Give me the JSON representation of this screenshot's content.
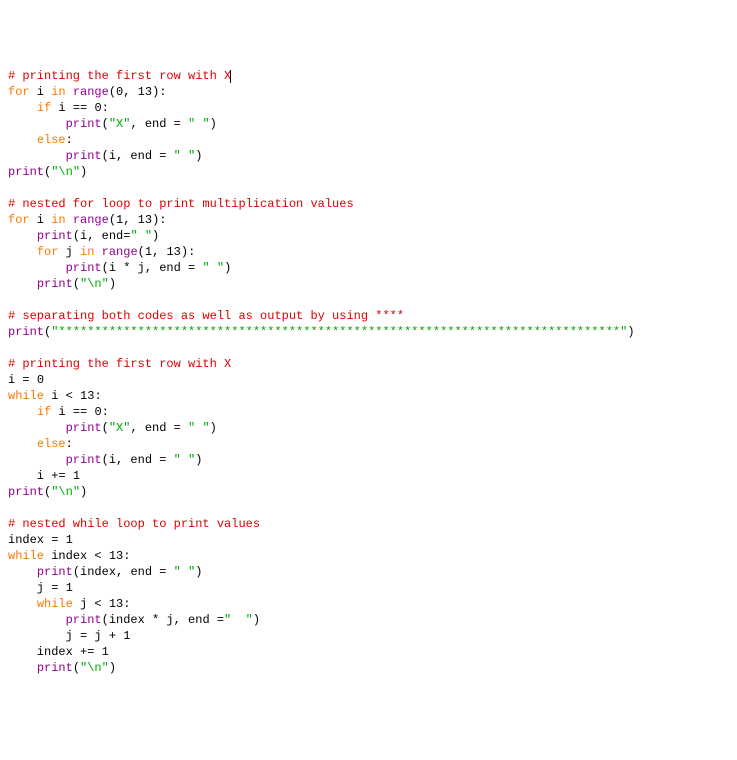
{
  "lines": [
    {
      "tokens": [
        {
          "t": "# printing the first row with X",
          "c": "cm"
        }
      ],
      "cursor": true
    },
    {
      "tokens": [
        {
          "t": "for",
          "c": "kw"
        },
        {
          "t": " i ",
          "c": "pl"
        },
        {
          "t": "in",
          "c": "kw"
        },
        {
          "t": " ",
          "c": "pl"
        },
        {
          "t": "range",
          "c": "bn"
        },
        {
          "t": "(",
          "c": "pl"
        },
        {
          "t": "0",
          "c": "pl"
        },
        {
          "t": ", ",
          "c": "pl"
        },
        {
          "t": "13",
          "c": "pl"
        },
        {
          "t": "):",
          "c": "pl"
        }
      ]
    },
    {
      "tokens": [
        {
          "t": "    ",
          "c": "pl"
        },
        {
          "t": "if",
          "c": "kw"
        },
        {
          "t": " i == ",
          "c": "pl"
        },
        {
          "t": "0",
          "c": "pl"
        },
        {
          "t": ":",
          "c": "pl"
        }
      ]
    },
    {
      "tokens": [
        {
          "t": "        ",
          "c": "pl"
        },
        {
          "t": "print",
          "c": "bn"
        },
        {
          "t": "(",
          "c": "pl"
        },
        {
          "t": "\"X\"",
          "c": "st"
        },
        {
          "t": ", end = ",
          "c": "pl"
        },
        {
          "t": "\" \"",
          "c": "st"
        },
        {
          "t": ")",
          "c": "pl"
        }
      ]
    },
    {
      "tokens": [
        {
          "t": "    ",
          "c": "pl"
        },
        {
          "t": "else",
          "c": "kw"
        },
        {
          "t": ":",
          "c": "pl"
        }
      ]
    },
    {
      "tokens": [
        {
          "t": "        ",
          "c": "pl"
        },
        {
          "t": "print",
          "c": "bn"
        },
        {
          "t": "(i, end = ",
          "c": "pl"
        },
        {
          "t": "\" \"",
          "c": "st"
        },
        {
          "t": ")",
          "c": "pl"
        }
      ]
    },
    {
      "tokens": [
        {
          "t": "print",
          "c": "bn"
        },
        {
          "t": "(",
          "c": "pl"
        },
        {
          "t": "\"\\n\"",
          "c": "st"
        },
        {
          "t": ")",
          "c": "pl"
        }
      ]
    },
    {
      "tokens": [
        {
          "t": "",
          "c": "pl"
        }
      ]
    },
    {
      "tokens": [
        {
          "t": "# nested for loop to print multiplication values",
          "c": "cm"
        }
      ]
    },
    {
      "tokens": [
        {
          "t": "for",
          "c": "kw"
        },
        {
          "t": " i ",
          "c": "pl"
        },
        {
          "t": "in",
          "c": "kw"
        },
        {
          "t": " ",
          "c": "pl"
        },
        {
          "t": "range",
          "c": "bn"
        },
        {
          "t": "(",
          "c": "pl"
        },
        {
          "t": "1",
          "c": "pl"
        },
        {
          "t": ", ",
          "c": "pl"
        },
        {
          "t": "13",
          "c": "pl"
        },
        {
          "t": "):",
          "c": "pl"
        }
      ]
    },
    {
      "tokens": [
        {
          "t": "    ",
          "c": "pl"
        },
        {
          "t": "print",
          "c": "bn"
        },
        {
          "t": "(i, end=",
          "c": "pl"
        },
        {
          "t": "\" \"",
          "c": "st"
        },
        {
          "t": ")",
          "c": "pl"
        }
      ]
    },
    {
      "tokens": [
        {
          "t": "    ",
          "c": "pl"
        },
        {
          "t": "for",
          "c": "kw"
        },
        {
          "t": " j ",
          "c": "pl"
        },
        {
          "t": "in",
          "c": "kw"
        },
        {
          "t": " ",
          "c": "pl"
        },
        {
          "t": "range",
          "c": "bn"
        },
        {
          "t": "(",
          "c": "pl"
        },
        {
          "t": "1",
          "c": "pl"
        },
        {
          "t": ", ",
          "c": "pl"
        },
        {
          "t": "13",
          "c": "pl"
        },
        {
          "t": "):",
          "c": "pl"
        }
      ]
    },
    {
      "tokens": [
        {
          "t": "        ",
          "c": "pl"
        },
        {
          "t": "print",
          "c": "bn"
        },
        {
          "t": "(i * j, end = ",
          "c": "pl"
        },
        {
          "t": "\" \"",
          "c": "st"
        },
        {
          "t": ")",
          "c": "pl"
        }
      ]
    },
    {
      "tokens": [
        {
          "t": "    ",
          "c": "pl"
        },
        {
          "t": "print",
          "c": "bn"
        },
        {
          "t": "(",
          "c": "pl"
        },
        {
          "t": "\"\\n\"",
          "c": "st"
        },
        {
          "t": ")",
          "c": "pl"
        }
      ]
    },
    {
      "tokens": [
        {
          "t": "",
          "c": "pl"
        }
      ]
    },
    {
      "tokens": [
        {
          "t": "# separating both codes as well as output by using ****",
          "c": "cm"
        }
      ]
    },
    {
      "tokens": [
        {
          "t": "print",
          "c": "bn"
        },
        {
          "t": "(",
          "c": "pl"
        },
        {
          "t": "\"******************************************************************************\"",
          "c": "st"
        },
        {
          "t": ")",
          "c": "pl"
        }
      ]
    },
    {
      "tokens": [
        {
          "t": "",
          "c": "pl"
        }
      ]
    },
    {
      "tokens": [
        {
          "t": "# printing the first row with X",
          "c": "cm"
        }
      ]
    },
    {
      "tokens": [
        {
          "t": "i = ",
          "c": "pl"
        },
        {
          "t": "0",
          "c": "pl"
        }
      ]
    },
    {
      "tokens": [
        {
          "t": "while",
          "c": "kw"
        },
        {
          "t": " i < ",
          "c": "pl"
        },
        {
          "t": "13",
          "c": "pl"
        },
        {
          "t": ":",
          "c": "pl"
        }
      ]
    },
    {
      "tokens": [
        {
          "t": "    ",
          "c": "pl"
        },
        {
          "t": "if",
          "c": "kw"
        },
        {
          "t": " i == ",
          "c": "pl"
        },
        {
          "t": "0",
          "c": "pl"
        },
        {
          "t": ":",
          "c": "pl"
        }
      ]
    },
    {
      "tokens": [
        {
          "t": "        ",
          "c": "pl"
        },
        {
          "t": "print",
          "c": "bn"
        },
        {
          "t": "(",
          "c": "pl"
        },
        {
          "t": "\"X\"",
          "c": "st"
        },
        {
          "t": ", end = ",
          "c": "pl"
        },
        {
          "t": "\" \"",
          "c": "st"
        },
        {
          "t": ")",
          "c": "pl"
        }
      ]
    },
    {
      "tokens": [
        {
          "t": "    ",
          "c": "pl"
        },
        {
          "t": "else",
          "c": "kw"
        },
        {
          "t": ":",
          "c": "pl"
        }
      ]
    },
    {
      "tokens": [
        {
          "t": "        ",
          "c": "pl"
        },
        {
          "t": "print",
          "c": "bn"
        },
        {
          "t": "(i, end = ",
          "c": "pl"
        },
        {
          "t": "\" \"",
          "c": "st"
        },
        {
          "t": ")",
          "c": "pl"
        }
      ]
    },
    {
      "tokens": [
        {
          "t": "    i += ",
          "c": "pl"
        },
        {
          "t": "1",
          "c": "pl"
        }
      ]
    },
    {
      "tokens": [
        {
          "t": "print",
          "c": "bn"
        },
        {
          "t": "(",
          "c": "pl"
        },
        {
          "t": "\"\\n\"",
          "c": "st"
        },
        {
          "t": ")",
          "c": "pl"
        }
      ]
    },
    {
      "tokens": [
        {
          "t": "",
          "c": "pl"
        }
      ]
    },
    {
      "tokens": [
        {
          "t": "# nested while loop to print values",
          "c": "cm"
        }
      ]
    },
    {
      "tokens": [
        {
          "t": "index = ",
          "c": "pl"
        },
        {
          "t": "1",
          "c": "pl"
        }
      ]
    },
    {
      "tokens": [
        {
          "t": "while",
          "c": "kw"
        },
        {
          "t": " index < ",
          "c": "pl"
        },
        {
          "t": "13",
          "c": "pl"
        },
        {
          "t": ":",
          "c": "pl"
        }
      ]
    },
    {
      "tokens": [
        {
          "t": "    ",
          "c": "pl"
        },
        {
          "t": "print",
          "c": "bn"
        },
        {
          "t": "(index, end = ",
          "c": "pl"
        },
        {
          "t": "\" \"",
          "c": "st"
        },
        {
          "t": ")",
          "c": "pl"
        }
      ]
    },
    {
      "tokens": [
        {
          "t": "    j = ",
          "c": "pl"
        },
        {
          "t": "1",
          "c": "pl"
        }
      ]
    },
    {
      "tokens": [
        {
          "t": "    ",
          "c": "pl"
        },
        {
          "t": "while",
          "c": "kw"
        },
        {
          "t": " j < ",
          "c": "pl"
        },
        {
          "t": "13",
          "c": "pl"
        },
        {
          "t": ":",
          "c": "pl"
        }
      ]
    },
    {
      "tokens": [
        {
          "t": "        ",
          "c": "pl"
        },
        {
          "t": "print",
          "c": "bn"
        },
        {
          "t": "(index * j, end =",
          "c": "pl"
        },
        {
          "t": "\"  \"",
          "c": "st"
        },
        {
          "t": ")",
          "c": "pl"
        }
      ]
    },
    {
      "tokens": [
        {
          "t": "        j = j + ",
          "c": "pl"
        },
        {
          "t": "1",
          "c": "pl"
        }
      ]
    },
    {
      "tokens": [
        {
          "t": "    index += ",
          "c": "pl"
        },
        {
          "t": "1",
          "c": "pl"
        }
      ]
    },
    {
      "tokens": [
        {
          "t": "    ",
          "c": "pl"
        },
        {
          "t": "print",
          "c": "bn"
        },
        {
          "t": "(",
          "c": "pl"
        },
        {
          "t": "\"\\n\"",
          "c": "st"
        },
        {
          "t": ")",
          "c": "pl"
        }
      ]
    }
  ]
}
